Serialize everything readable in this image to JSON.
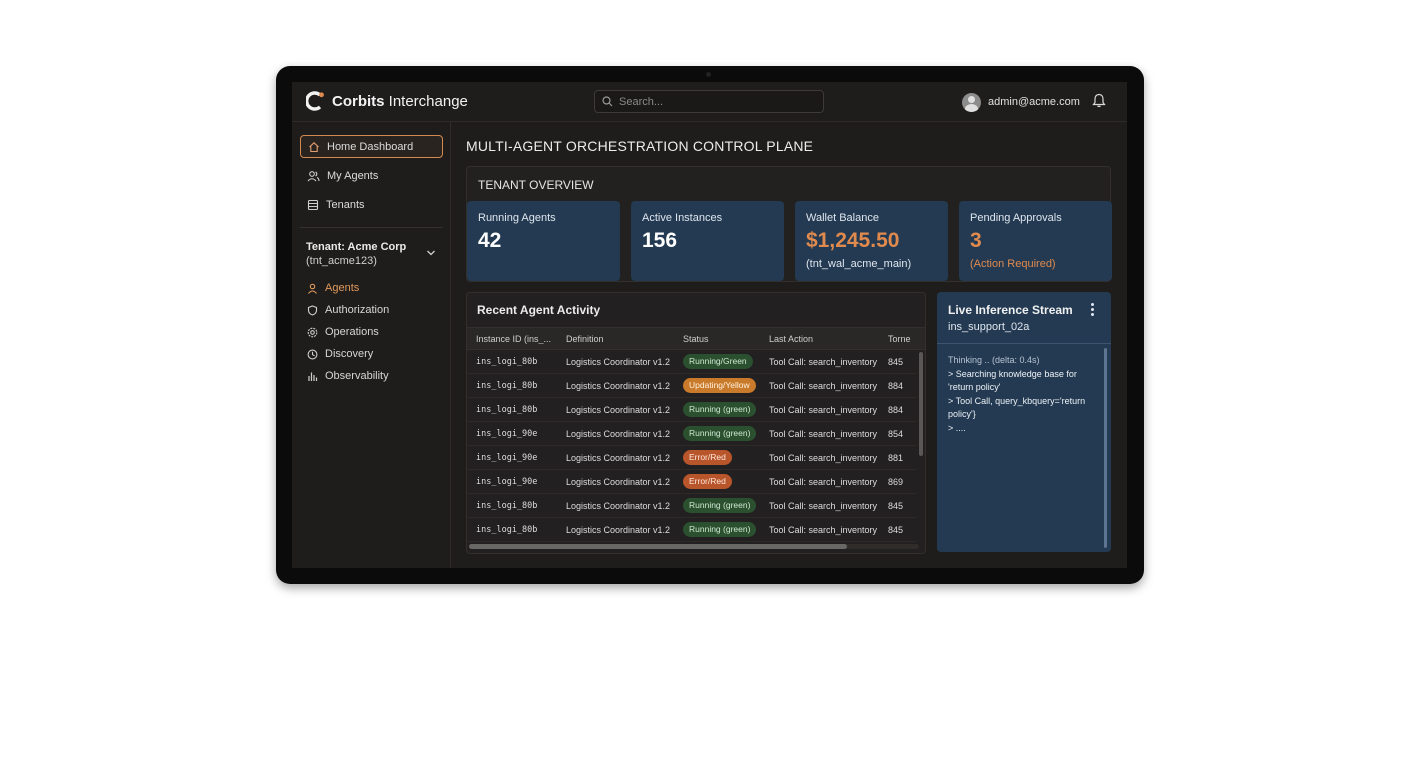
{
  "header": {
    "brand_bold": "Corbits",
    "brand_rest": " Interchange",
    "search_placeholder": "Search...",
    "user_email": "admin@acme.com"
  },
  "colors": {
    "accent": "#e08a4e",
    "card_bg": "#233a52",
    "screen_bg": "#1f1d1c"
  },
  "sidebar": {
    "items": [
      {
        "label": "Home Dashboard",
        "icon": "home-icon",
        "active": true
      },
      {
        "label": "My Agents",
        "icon": "users-icon"
      },
      {
        "label": "Tenants",
        "icon": "building-icon"
      }
    ],
    "tenant": {
      "name": "Tenant: Acme Corp",
      "id": "(tnt_acme123)"
    },
    "sub_items": [
      {
        "label": "Agents",
        "icon": "agent-icon",
        "active": true
      },
      {
        "label": "Authorization",
        "icon": "shield-icon"
      },
      {
        "label": "Operations",
        "icon": "gear-icon"
      },
      {
        "label": "Discovery",
        "icon": "clock-icon"
      },
      {
        "label": "Observability",
        "icon": "bars-icon"
      }
    ]
  },
  "main": {
    "title": "MULTI-AGENT ORCHESTRATION CONTROL PLANE",
    "overview": {
      "title": "TENANT OVERVIEW",
      "cards": [
        {
          "label": "Running Agents",
          "value": "42",
          "sub": ""
        },
        {
          "label": "Active Instances",
          "value": "156",
          "sub": ""
        },
        {
          "label": "Wallet Balance",
          "value": "$1,245.50",
          "sub": "(tnt_wal_acme_main)"
        },
        {
          "label": "Pending Approvals",
          "value": "3",
          "sub": "(Action Required)"
        }
      ]
    },
    "activity": {
      "title": "Recent Agent Activity",
      "columns": [
        "Instance ID (ins_...",
        "Definition",
        "Status",
        "Last Action",
        "Torne"
      ],
      "rows": [
        {
          "id": "ins_logi_80b",
          "def": "Logistics Coordinator v1.2",
          "status": "Running/Green",
          "status_kind": "green",
          "action": "Tool Call: search_inventory",
          "tokens": "845"
        },
        {
          "id": "ins_logi_80b",
          "def": "Logistics Coordinator v1.2",
          "status": "Updating/Yellow",
          "status_kind": "yellow",
          "action": "Tool Call: search_inventory",
          "tokens": "884"
        },
        {
          "id": "ins_logi_80b",
          "def": "Logistics Coordinator v1.2",
          "status": "Running (green)",
          "status_kind": "green",
          "action": "Tool Call: search_inventory",
          "tokens": "884"
        },
        {
          "id": "ins_logi_90e",
          "def": "Logistics Coordinator v1.2",
          "status": "Running (green)",
          "status_kind": "green",
          "action": "Tool Call: search_inventory",
          "tokens": "854"
        },
        {
          "id": "ins_logi_90e",
          "def": "Logistics Coordinator v1.2",
          "status": "Error/Red",
          "status_kind": "red",
          "action": "Tool Call: search_inventory",
          "tokens": "881"
        },
        {
          "id": "ins_logi_90e",
          "def": "Logistics Coordinator v1.2",
          "status": "Error/Red",
          "status_kind": "red",
          "action": "Tool Call: search_inventory",
          "tokens": "869"
        },
        {
          "id": "ins_logi_80b",
          "def": "Logistics Coordinator v1.2",
          "status": "Running (green)",
          "status_kind": "green",
          "action": "Tool Call: search_inventory",
          "tokens": "845"
        },
        {
          "id": "ins_logi_80b",
          "def": "Logistics Coordinator v1.2",
          "status": "Running (green)",
          "status_kind": "green",
          "action": "Tool Call: search_inventory",
          "tokens": "845"
        }
      ]
    },
    "stream": {
      "title": "Live Inference Stream",
      "instance": "ins_support_02a",
      "lines": [
        "Thinking .. (delta: 0.4s)",
        "> Searching knowledge base for 'return policy'",
        "> Tool Call, query_kbquery='return policy'}",
        "> ...."
      ]
    }
  }
}
